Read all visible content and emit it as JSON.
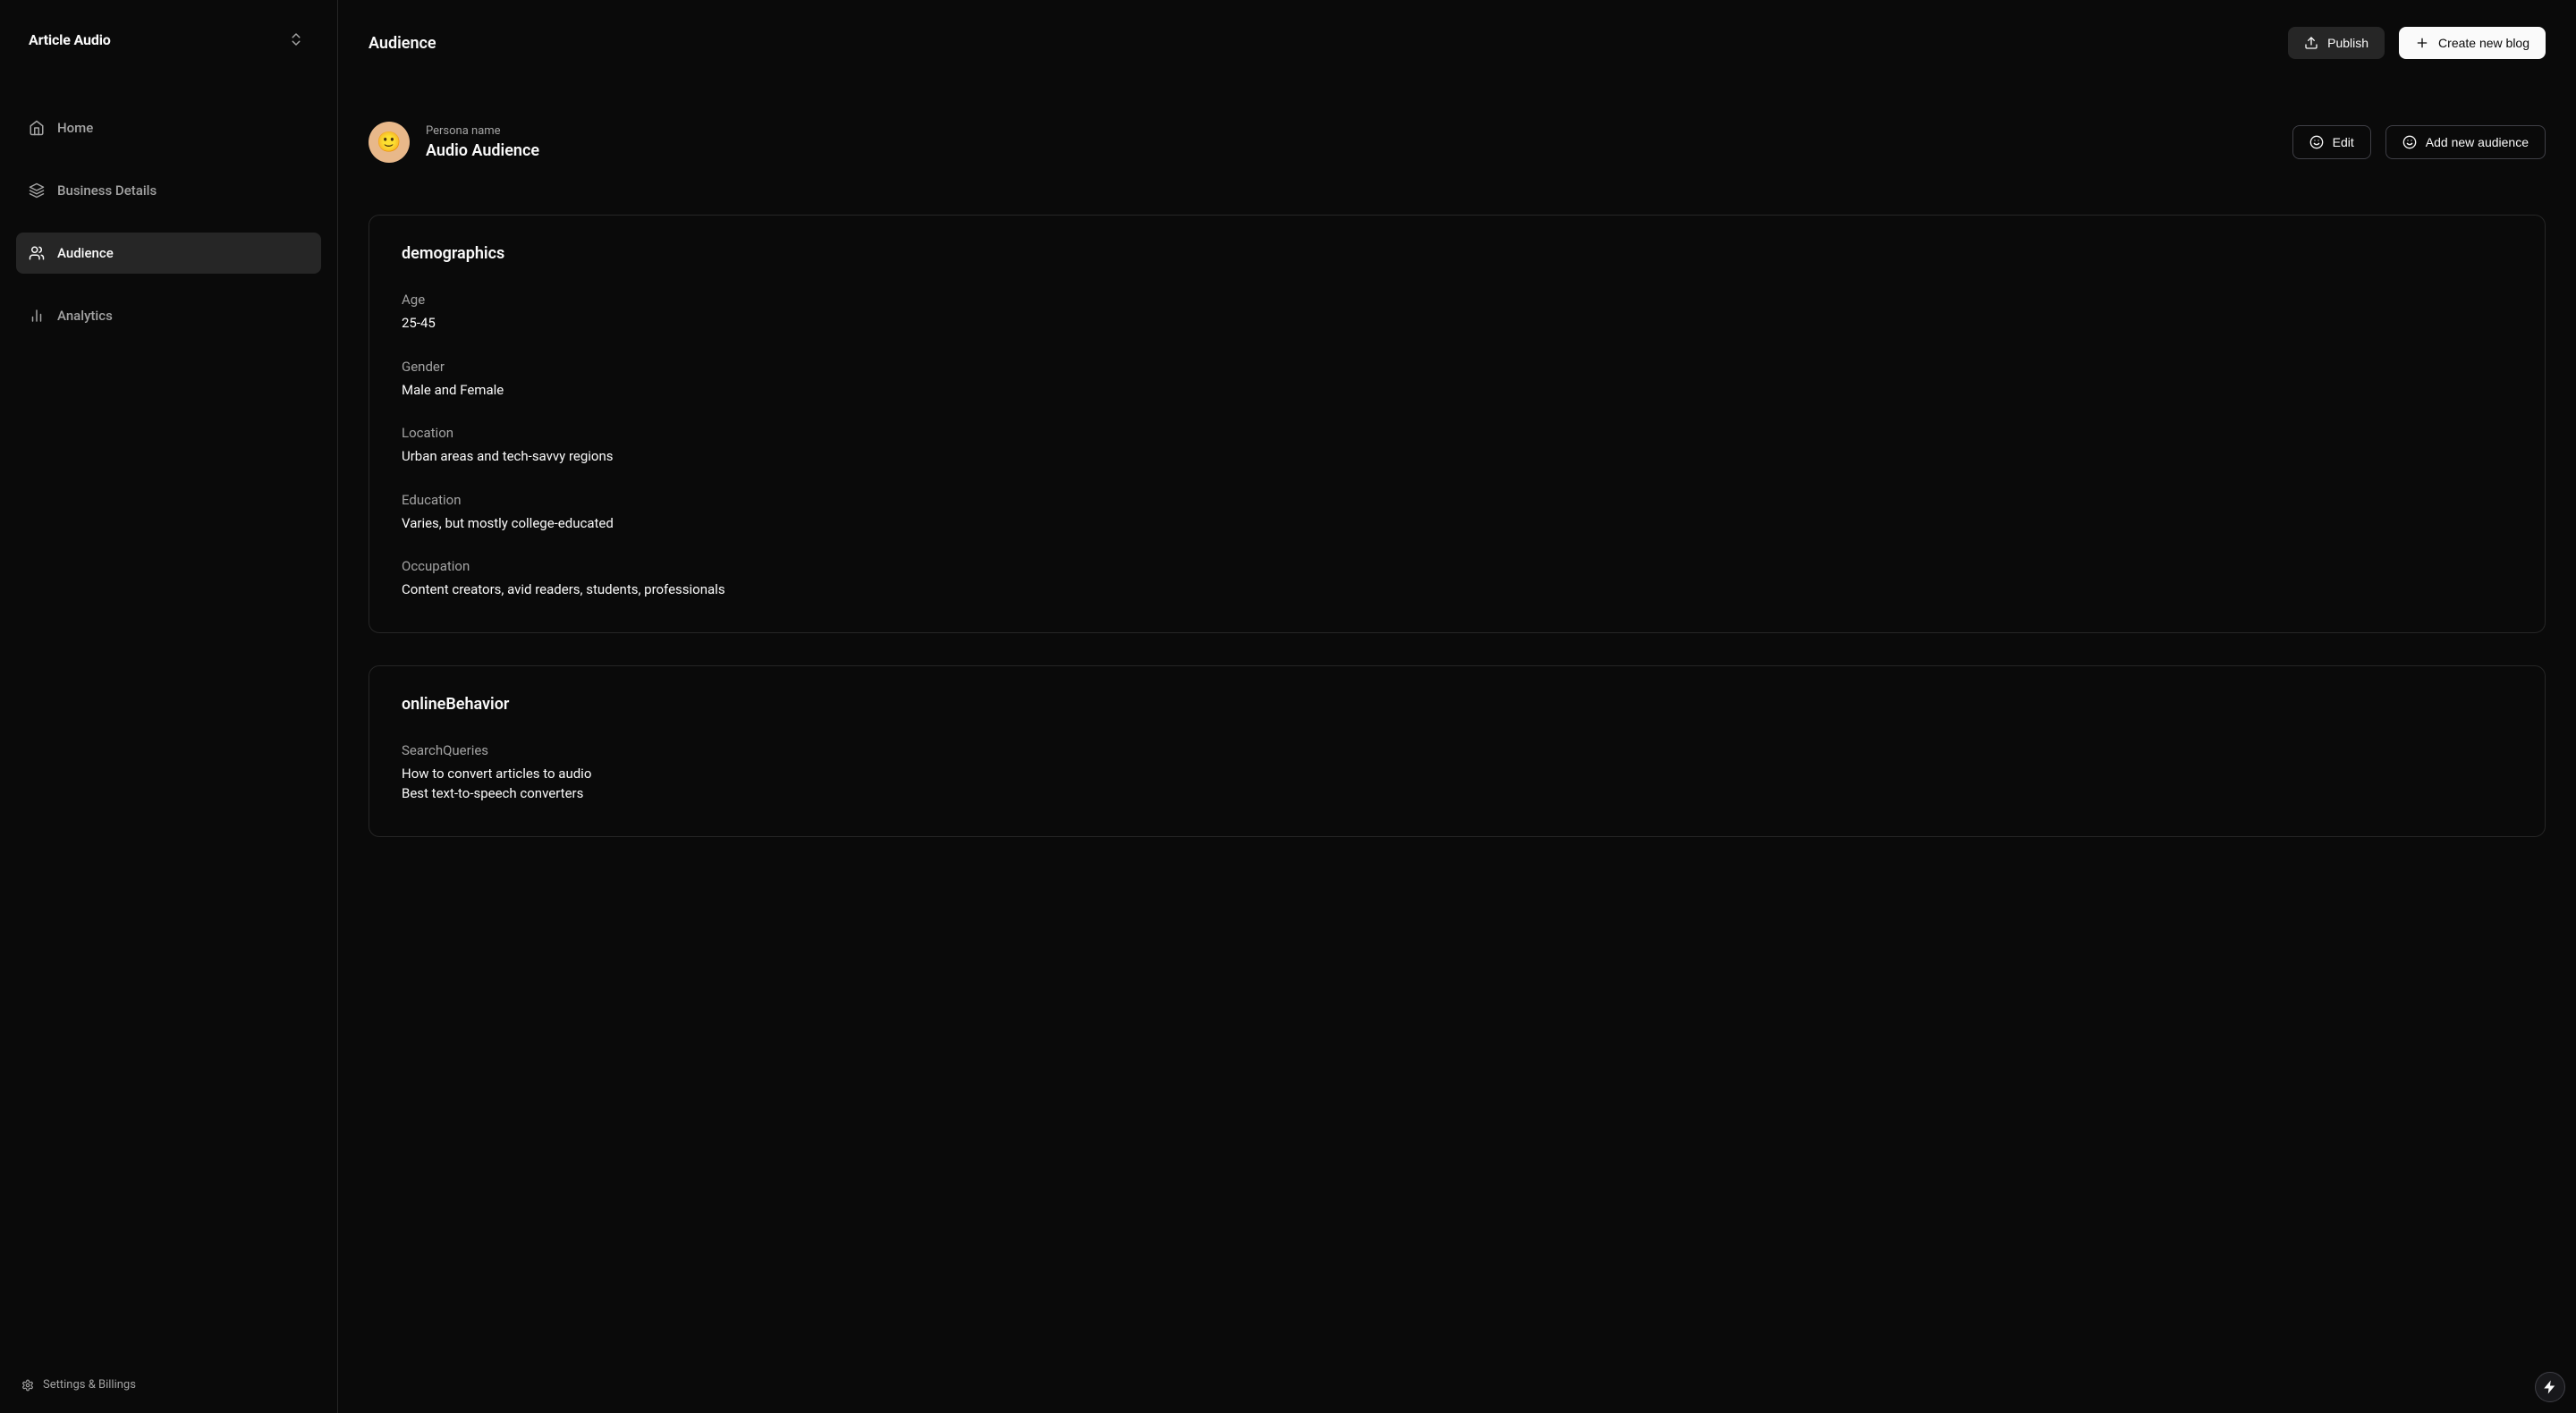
{
  "brand": "Article Audio",
  "page_title": "Audience",
  "header": {
    "publish_label": "Publish",
    "create_label": "Create new blog"
  },
  "sidebar": {
    "items": [
      {
        "label": "Home",
        "icon": "home"
      },
      {
        "label": "Business Details",
        "icon": "layers"
      },
      {
        "label": "Audience",
        "icon": "users",
        "active": true
      },
      {
        "label": "Analytics",
        "icon": "chart"
      }
    ],
    "settings_label": "Settings & Billings"
  },
  "persona": {
    "meta_label": "Persona name",
    "name": "Audio Audience",
    "emoji": "🙂",
    "edit_label": "Edit",
    "add_label": "Add new audience"
  },
  "sections": [
    {
      "title": "demographics",
      "fields": [
        {
          "label": "Age",
          "value": "25-45"
        },
        {
          "label": "Gender",
          "value": "Male and Female"
        },
        {
          "label": "Location",
          "value": "Urban areas and tech-savvy regions"
        },
        {
          "label": "Education",
          "value": "Varies, but mostly college-educated"
        },
        {
          "label": "Occupation",
          "value": "Content creators, avid readers, students, professionals"
        }
      ]
    },
    {
      "title": "onlineBehavior",
      "fields": [
        {
          "label": "SearchQueries",
          "value": "How to convert articles to audio\nBest text-to-speech converters"
        }
      ]
    }
  ]
}
